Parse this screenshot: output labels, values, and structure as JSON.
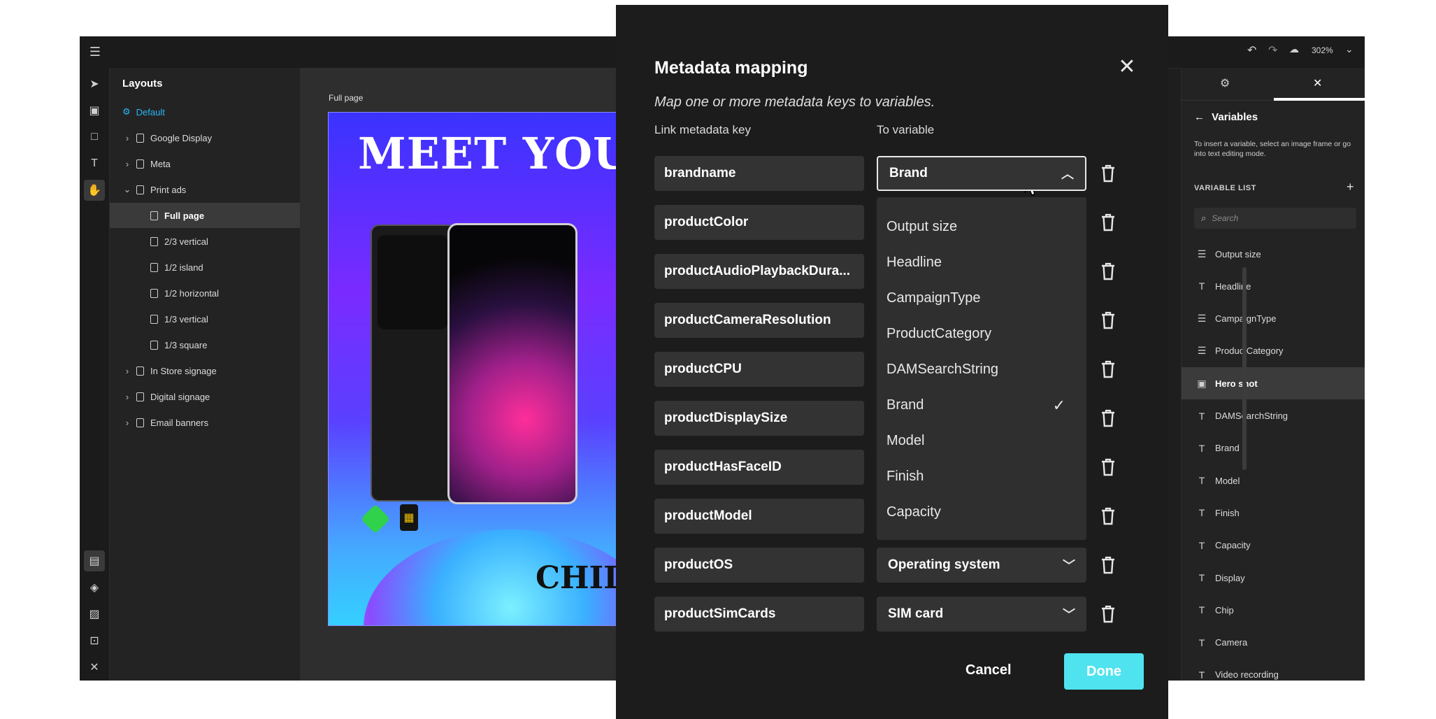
{
  "topbar": {
    "zoom": "302%"
  },
  "layouts": {
    "title": "Layouts",
    "items": [
      {
        "label": "Default",
        "depth": 0,
        "kind": "default"
      },
      {
        "label": "Google Display",
        "depth": 1,
        "kind": "collapsed"
      },
      {
        "label": "Meta",
        "depth": 1,
        "kind": "collapsed"
      },
      {
        "label": "Print ads",
        "depth": 1,
        "kind": "expanded"
      },
      {
        "label": "Full page",
        "depth": 2,
        "kind": "selected"
      },
      {
        "label": "2/3 vertical",
        "depth": 2,
        "kind": "child"
      },
      {
        "label": "1/2 island",
        "depth": 2,
        "kind": "child"
      },
      {
        "label": "1/2 horizontal",
        "depth": 2,
        "kind": "child"
      },
      {
        "label": "1/3 vertical",
        "depth": 2,
        "kind": "child"
      },
      {
        "label": "1/3 square",
        "depth": 2,
        "kind": "child"
      },
      {
        "label": "In Store signage",
        "depth": 1,
        "kind": "collapsed"
      },
      {
        "label": "Digital signage",
        "depth": 1,
        "kind": "collapsed"
      },
      {
        "label": "Email banners",
        "depth": 1,
        "kind": "collapsed"
      }
    ]
  },
  "canvas": {
    "label": "Full page",
    "headline": "MEET YOUR",
    "footer_text": "CHILL"
  },
  "right_panel": {
    "title": "Variables",
    "hint": "To insert a variable, select an image frame or go into text editing mode.",
    "list_title": "VARIABLE LIST",
    "search_placeholder": "Search",
    "variables": [
      {
        "label": "Output size",
        "type": "list"
      },
      {
        "label": "Headline",
        "type": "text"
      },
      {
        "label": "CampaignType",
        "type": "list"
      },
      {
        "label": "ProductCategory",
        "type": "list"
      },
      {
        "label": "Hero shot",
        "type": "image",
        "selected": true
      },
      {
        "label": "DAMSearchString",
        "type": "text"
      },
      {
        "label": "Brand",
        "type": "text"
      },
      {
        "label": "Model",
        "type": "text"
      },
      {
        "label": "Finish",
        "type": "text"
      },
      {
        "label": "Capacity",
        "type": "text"
      },
      {
        "label": "Display",
        "type": "text"
      },
      {
        "label": "Chip",
        "type": "text"
      },
      {
        "label": "Camera",
        "type": "text"
      },
      {
        "label": "Video recording",
        "type": "text"
      }
    ]
  },
  "modal": {
    "title": "Metadata mapping",
    "subtitle": "Map one or more metadata keys to variables.",
    "col_key": "Link metadata key",
    "col_var": "To variable",
    "rows": [
      {
        "key": "brandname",
        "variable": "Brand",
        "open": true
      },
      {
        "key": "productColor",
        "variable": ""
      },
      {
        "key": "productAudioPlaybackDura...",
        "variable": ""
      },
      {
        "key": "productCameraResolution",
        "variable": ""
      },
      {
        "key": "productCPU",
        "variable": ""
      },
      {
        "key": "productDisplaySize",
        "variable": ""
      },
      {
        "key": "productHasFaceID",
        "variable": ""
      },
      {
        "key": "productModel",
        "variable": ""
      },
      {
        "key": "productOS",
        "variable": "Operating system"
      },
      {
        "key": "productSimCards",
        "variable": "SIM card"
      }
    ],
    "dropdown_options": [
      {
        "label": "Output size"
      },
      {
        "label": "Headline"
      },
      {
        "label": "CampaignType"
      },
      {
        "label": "ProductCategory"
      },
      {
        "label": "DAMSearchString"
      },
      {
        "label": "Brand",
        "checked": true
      },
      {
        "label": "Model"
      },
      {
        "label": "Finish"
      },
      {
        "label": "Capacity"
      }
    ],
    "cancel_label": "Cancel",
    "done_label": "Done",
    "accent_color": "#4fe3ef"
  }
}
